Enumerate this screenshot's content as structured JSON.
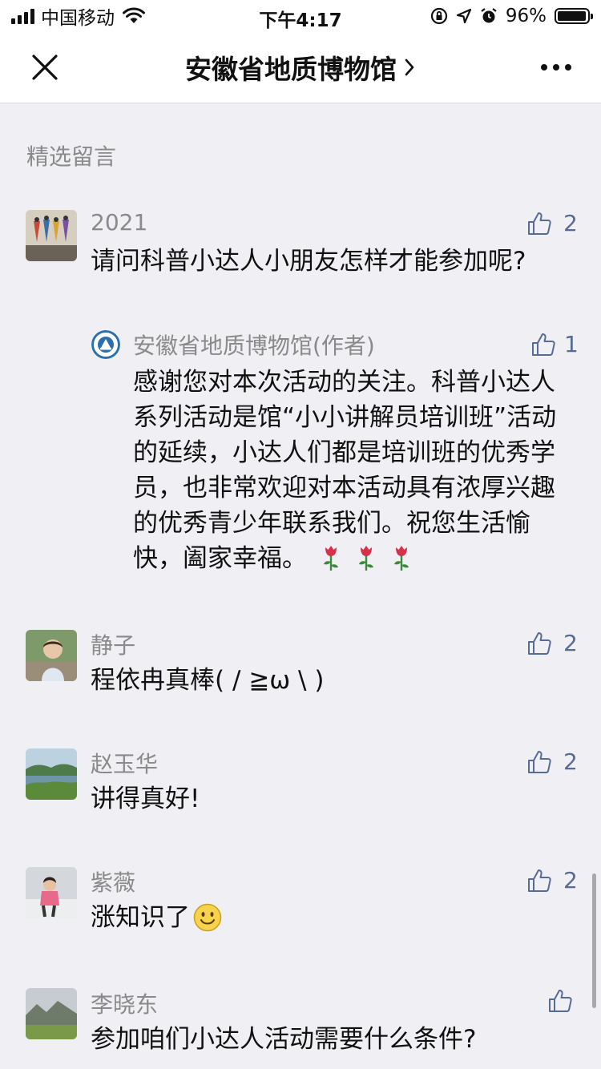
{
  "status_bar": {
    "carrier": "中国移动",
    "time": "下午4:17",
    "battery": "96%",
    "battery_level": 0.96
  },
  "nav": {
    "title": "安徽省地质博物馆",
    "icons": [
      "close-icon",
      "chevron-right-icon",
      "more-icon"
    ]
  },
  "section_title": "精选留言",
  "comments": [
    {
      "name": "2021",
      "text": "请问科普小达人小朋友怎样才能参加呢?",
      "likes": "2",
      "reply": {
        "name": "安徽省地质博物馆(作者)",
        "text": "感谢您对本次活动的关注。科普小达人系列活动是馆“小小讲解员培训班”活动的延续，小达人们都是培训班的优秀学员，也非常欢迎对本活动具有浓厚兴趣的优秀青少年联系我们。祝您生活愉快，阖家幸福。",
        "likes": "1"
      }
    },
    {
      "name": "静子",
      "text": "程依冉真棒( / ≧ω \\ )",
      "likes": "2"
    },
    {
      "name": "赵玉华",
      "text": "讲得真好!",
      "likes": "2"
    },
    {
      "name": "紫薇",
      "text": "涨知识了",
      "likes": "2"
    },
    {
      "name": "李晓东",
      "text": "参加咱们小达人活动需要什么条件?",
      "likes": ""
    }
  ],
  "colors": {
    "background": "#efeff4",
    "link_blue": "#576b95",
    "meta_gray": "#8a8a8a"
  }
}
